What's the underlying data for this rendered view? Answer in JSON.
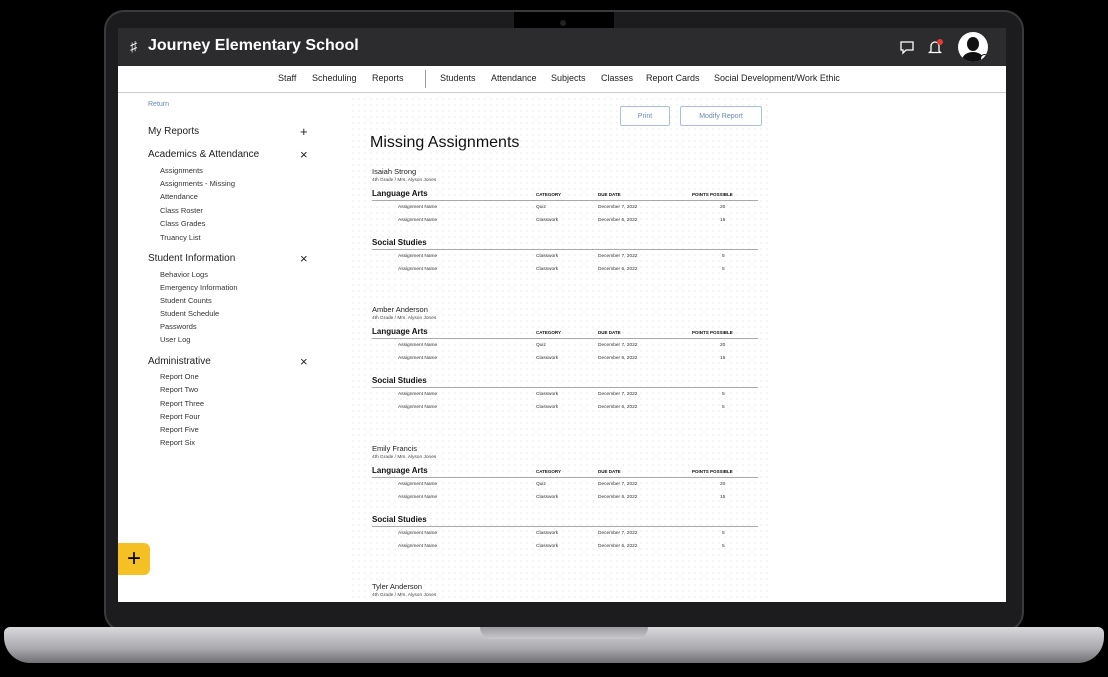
{
  "app": {
    "title": "Journey Elementary School"
  },
  "topbar": {
    "icons": [
      "chat-icon",
      "notification-bell-icon",
      "user-avatar"
    ]
  },
  "nav": [
    "Staff",
    "Scheduling",
    "Reports",
    "Students",
    "Attendance",
    "Subjects",
    "Classes",
    "Report Cards",
    "Social Development/Work Ethic"
  ],
  "sidebar": {
    "return_label": "Return",
    "sections": [
      {
        "title": "My Reports",
        "control": "+",
        "items": []
      },
      {
        "title": "Academics & Attendance",
        "control": "×",
        "items": [
          "Assignments",
          "Assignments - Missing",
          "Attendance",
          "Class Roster",
          "Class Grades",
          "Truancy List"
        ]
      },
      {
        "title": "Student Information",
        "control": "×",
        "items": [
          "Behavior Logs",
          "Emergency Information",
          "Student Counts",
          "Student Schedule",
          "Passwords",
          "User Log"
        ]
      },
      {
        "title": "Administrative",
        "control": "×",
        "items": [
          "Report One",
          "Report Two",
          "Report Three",
          "Report Four",
          "Report Five",
          "Report Six"
        ]
      }
    ],
    "fab_label": "+"
  },
  "report": {
    "print_label": "Print",
    "modify_label": "Modify Report",
    "title": "Missing Assignments",
    "columns": {
      "category": "CATEGORY",
      "due": "DUE DATE",
      "points": "POINTS POSSIBLE"
    },
    "students": [
      {
        "name": "Isaiah Strong",
        "sub": "4th Grade / Mrs. Alyson Jones",
        "subjects": [
          {
            "name": "Language Arts",
            "rows": [
              {
                "assignment": "Assignment Name",
                "category": "Quiz",
                "due": "December 7, 2022",
                "points": "20"
              },
              {
                "assignment": "Assignment Name",
                "category": "Classwork",
                "due": "December 6, 2022",
                "points": "15"
              }
            ]
          },
          {
            "name": "Social Studies",
            "rows": [
              {
                "assignment": "Assignment Name",
                "category": "Classwork",
                "due": "December 7, 2022",
                "points": "5"
              },
              {
                "assignment": "Assignment Name",
                "category": "Classwork",
                "due": "December 6, 2022",
                "points": "5"
              }
            ]
          }
        ]
      },
      {
        "name": "Amber Anderson",
        "sub": "4th Grade / Mrs. Alyson Jones",
        "subjects": [
          {
            "name": "Language Arts",
            "rows": [
              {
                "assignment": "Assignment Name",
                "category": "Quiz",
                "due": "December 7, 2022",
                "points": "20"
              },
              {
                "assignment": "Assignment Name",
                "category": "Classwork",
                "due": "December 6, 2022",
                "points": "15"
              }
            ]
          },
          {
            "name": "Social Studies",
            "rows": [
              {
                "assignment": "Assignment Name",
                "category": "Classwork",
                "due": "December 7, 2022",
                "points": "5"
              },
              {
                "assignment": "Assignment Name",
                "category": "Classwork",
                "due": "December 6, 2022",
                "points": "5"
              }
            ]
          }
        ]
      },
      {
        "name": "Emily Francis",
        "sub": "4th Grade / Mrs. Alyson Jones",
        "subjects": [
          {
            "name": "Language Arts",
            "rows": [
              {
                "assignment": "Assignment Name",
                "category": "Quiz",
                "due": "December 7, 2022",
                "points": "20"
              },
              {
                "assignment": "Assignment Name",
                "category": "Classwork",
                "due": "December 6, 2022",
                "points": "15"
              }
            ]
          },
          {
            "name": "Social Studies",
            "rows": [
              {
                "assignment": "Assignment Name",
                "category": "Classwork",
                "due": "December 7, 2022",
                "points": "5"
              },
              {
                "assignment": "Assignment Name",
                "category": "Classwork",
                "due": "December 6, 2022",
                "points": "5"
              }
            ]
          }
        ]
      },
      {
        "name": "Tyler Anderson",
        "sub": "4th Grade / Mrs. Alyson Jones",
        "subjects": []
      }
    ]
  },
  "colors": {
    "accent": "#f5c023",
    "topbar": "#2c2c2e",
    "link": "#6a87b5",
    "notification": "#e53935"
  }
}
